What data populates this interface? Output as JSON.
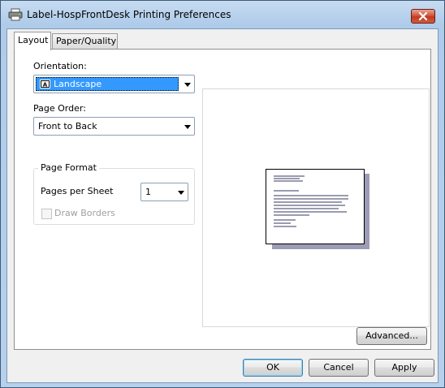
{
  "window": {
    "title": "Label-HospFrontDesk Printing Preferences"
  },
  "tabs": [
    {
      "label": "Layout",
      "active": true
    },
    {
      "label": "Paper/Quality",
      "active": false
    }
  ],
  "layout": {
    "orientation_label": "Orientation:",
    "orientation_value": "Landscape",
    "page_order_label": "Page Order:",
    "page_order_value": "Front to Back",
    "page_format_label": "Page Format",
    "pages_per_sheet_label": "Pages per Sheet",
    "pages_per_sheet_value": "1",
    "draw_borders_label": "Draw Borders",
    "draw_borders_checked": false,
    "draw_borders_enabled": false
  },
  "buttons": {
    "advanced": "Advanced...",
    "ok": "OK",
    "cancel": "Cancel",
    "apply": "Apply"
  },
  "icons": {
    "title": "printer-icon",
    "close": "close-icon",
    "orientation": "landscape-orientation-icon"
  },
  "colors": {
    "selection": "#3399ff",
    "close_button": "#c94a2d",
    "default_button_border": "#3c7fb1"
  }
}
